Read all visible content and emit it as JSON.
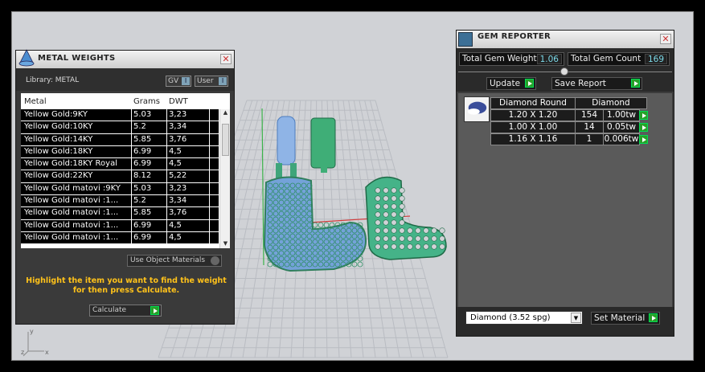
{
  "metal_weights": {
    "title": "METAL WEIGHTS",
    "library_label": "Library: METAL",
    "gv_label": "GV",
    "user_label": "User",
    "columns": [
      "Metal",
      "Grams",
      "DWT"
    ],
    "rows": [
      [
        "Yellow Gold:9KY",
        "5.03",
        "3,23"
      ],
      [
        "Yellow Gold:10KY",
        "5.2",
        "3,34"
      ],
      [
        "Yellow Gold:14KY",
        "5.85",
        "3,76"
      ],
      [
        "Yellow Gold:18KY",
        "6.99",
        "4,5"
      ],
      [
        "Yellow Gold:18KY Royal",
        "6.99",
        "4,5"
      ],
      [
        "Yellow Gold:22KY",
        "8.12",
        "5,22"
      ],
      [
        "Yellow Gold matovi :9KY",
        "5.03",
        "3,23"
      ],
      [
        "Yellow Gold matovi :1...",
        "5.2",
        "3,34"
      ],
      [
        "Yellow Gold matovi :1...",
        "5.85",
        "3,76"
      ],
      [
        "Yellow Gold matovi :1...",
        "6.99",
        "4,5"
      ],
      [
        "Yellow Gold matovi :1...",
        "6.99",
        "4,5"
      ]
    ],
    "use_object_materials": "Use Object Materials",
    "hint": "Highlight the item you want to find the weight for then press Calculate.",
    "calculate_label": "Calculate"
  },
  "gem_reporter": {
    "title": "GEM REPORTER",
    "total_weight_label": "Total Gem Weight",
    "total_weight_value": "1.06",
    "total_count_label": "Total Gem Count",
    "total_count_value": "169",
    "update_label": "Update",
    "save_report_label": "Save Report",
    "gem_header_shape": "Diamond Round",
    "gem_header_material": "Diamond",
    "gems": [
      {
        "size": "1.20 X 1.20",
        "count": "154",
        "weight": "1.00tw"
      },
      {
        "size": "1.00 X 1.00",
        "count": "14",
        "weight": "0.05tw"
      },
      {
        "size": "1.16 X 1.16",
        "count": "1",
        "weight": "0.006tw"
      }
    ],
    "material_select": "Diamond     (3.52 spg)",
    "set_material_label": "Set Material"
  },
  "viewport": {
    "axis_y": "y",
    "axis_x": "x",
    "axis_z": "z"
  },
  "colors": {
    "accent_green": "#28a028",
    "hint_yellow": "#ffc21a",
    "gem_value_cyan": "#7cd9e8"
  }
}
